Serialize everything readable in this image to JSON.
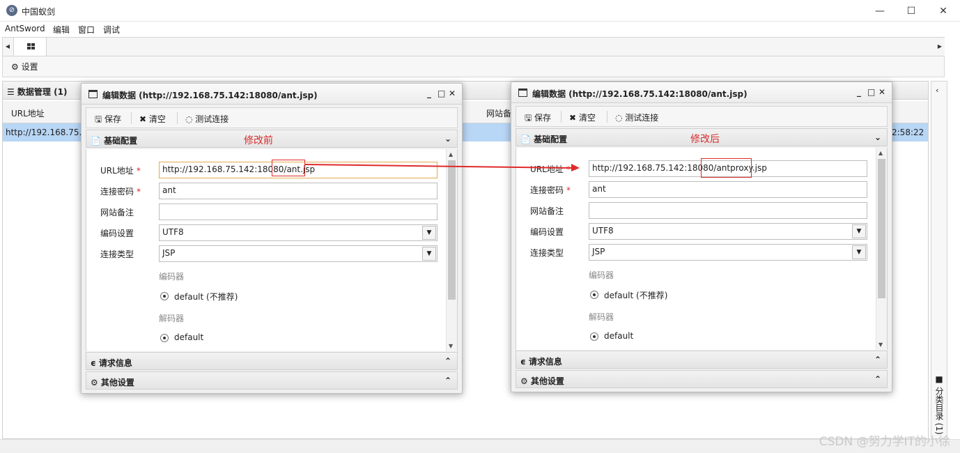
{
  "window": {
    "title": "中国蚁剑",
    "minimize": "—",
    "maximize": "☐",
    "close": "✕"
  },
  "menu": [
    "AntSword",
    "编辑",
    "窗口",
    "调试"
  ],
  "tabbar": {
    "left": "◀",
    "right": "▶"
  },
  "toolbar": {
    "settings": "⚙ 设置"
  },
  "main": {
    "panel_title": "☰ 数据管理 (1)",
    "columns": {
      "url": "URL地址",
      "note": "网站备"
    },
    "row": {
      "url": "http://192.168.75.1",
      "time": "2:58:22"
    }
  },
  "sidebar": {
    "chevron": "‹",
    "label": "■ 分类目录 (1)"
  },
  "dialog": {
    "title": "编辑数据 (http://192.168.75.142:18080/ant.jsp)",
    "min": "_",
    "max": "□",
    "close": "✕",
    "save": "🖫 保存",
    "clear": "✖ 清空",
    "test": "◌ 测试连接",
    "base_section": "📄 基础配置",
    "request_section": "ϵ 请求信息",
    "other_section": "⚙ 其他设置",
    "fields": {
      "url_label": "URL地址",
      "password_label": "连接密码",
      "note_label": "网站备注",
      "encoding_label": "编码设置",
      "type_label": "连接类型",
      "required": "*"
    },
    "password": "ant",
    "note": "",
    "encoding": "UTF8",
    "type": "JSP",
    "encoder_group": "编码器",
    "encoder_option": "default (不推荐)",
    "decoder_group": "解码器",
    "decoder_option": "default"
  },
  "before": {
    "annotation": "修改前",
    "url_prefix": "http://192.168.75.142:18080/",
    "url_file": "ant.jsp"
  },
  "after": {
    "annotation": "修改后",
    "url_prefix": "http://192.168.75.142:18080/",
    "url_file": "antproxy.jsp"
  },
  "colors": {
    "annotation": "#d62c2c",
    "selection": "#b8d6f5"
  },
  "watermark": "CSDN @努力学IT的小徐"
}
